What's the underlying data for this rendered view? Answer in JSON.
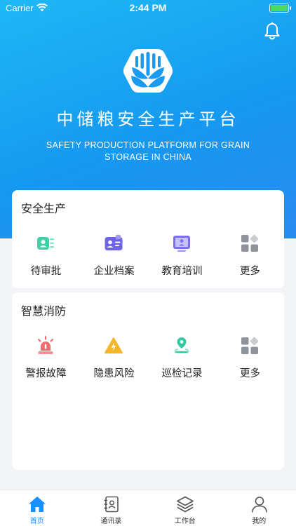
{
  "status_bar": {
    "carrier": "Carrier",
    "time": "2:44 PM"
  },
  "header": {
    "title": "中储粮安全生产平台",
    "subtitle": "SAFETY PRODUCTION PLATFORM FOR GRAIN STORAGE IN CHINA"
  },
  "sections": [
    {
      "title": "安全生产",
      "items": [
        {
          "label": "待审批",
          "icon": "approval-icon"
        },
        {
          "label": "企业档案",
          "icon": "enterprise-file-icon"
        },
        {
          "label": "教育培训",
          "icon": "training-icon"
        },
        {
          "label": "更多",
          "icon": "more-grid-icon"
        }
      ]
    },
    {
      "title": "智慧消防",
      "items": [
        {
          "label": "警报故障",
          "icon": "alarm-icon"
        },
        {
          "label": "隐患风险",
          "icon": "hazard-warning-icon"
        },
        {
          "label": "巡检记录",
          "icon": "inspection-location-icon"
        },
        {
          "label": "更多",
          "icon": "more-grid-icon"
        }
      ]
    }
  ],
  "tabbar": {
    "tabs": [
      {
        "label": "首页",
        "icon": "home-icon",
        "active": true
      },
      {
        "label": "通讯录",
        "icon": "contacts-icon",
        "active": false
      },
      {
        "label": "工作台",
        "icon": "layers-icon",
        "active": false
      },
      {
        "label": "我的",
        "icon": "user-icon",
        "active": false
      }
    ]
  },
  "colors": {
    "brand_blue": "#1890ff",
    "hero_gradient_start": "#1fb8f5",
    "hero_gradient_end": "#2a8af0",
    "battery_green": "#4cd964"
  }
}
